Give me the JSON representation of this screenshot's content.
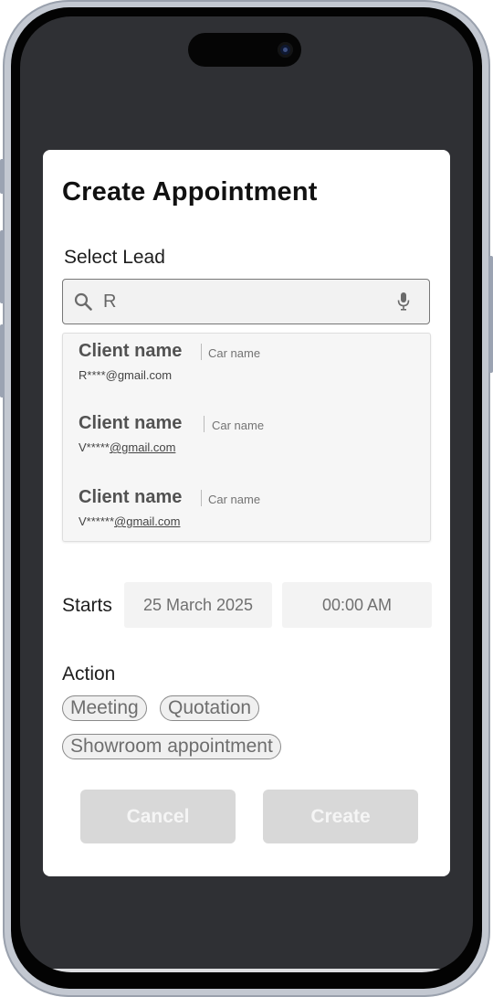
{
  "modal": {
    "title": "Create Appointment",
    "select_lead_label": "Select Lead",
    "search": {
      "value": "R"
    },
    "results": [
      {
        "client": "Client name",
        "car": "Car name",
        "email_masked": "R****@gmail.com",
        "email_prefix": "R****",
        "email_domain": "@gmail.com",
        "domain_underlined": false
      },
      {
        "client": "Client name",
        "car": "Car name",
        "email_masked": "V*****@gmail.com",
        "email_prefix": "V*****",
        "email_domain": "@gmail.com",
        "domain_underlined": true
      },
      {
        "client": "Client name",
        "car": "Car name",
        "email_masked": "V******@gmail.com",
        "email_prefix": "V******",
        "email_domain": "@gmail.com",
        "domain_underlined": true
      }
    ],
    "starts_label": "Starts",
    "start_date": "25 March 2025",
    "start_time": "00:00 AM",
    "action_label": "Action",
    "actions": [
      "Meeting",
      "Quotation",
      "Showroom appointment"
    ],
    "cancel_label": "Cancel",
    "create_label": "Create"
  },
  "icons": {
    "search": "search-icon",
    "mic": "microphone-icon"
  },
  "colors": {
    "backdrop": "#2f3034",
    "modal_bg": "#ffffff",
    "field_bg": "#f3f3f3",
    "disabled_button": "#d8d8d8"
  }
}
